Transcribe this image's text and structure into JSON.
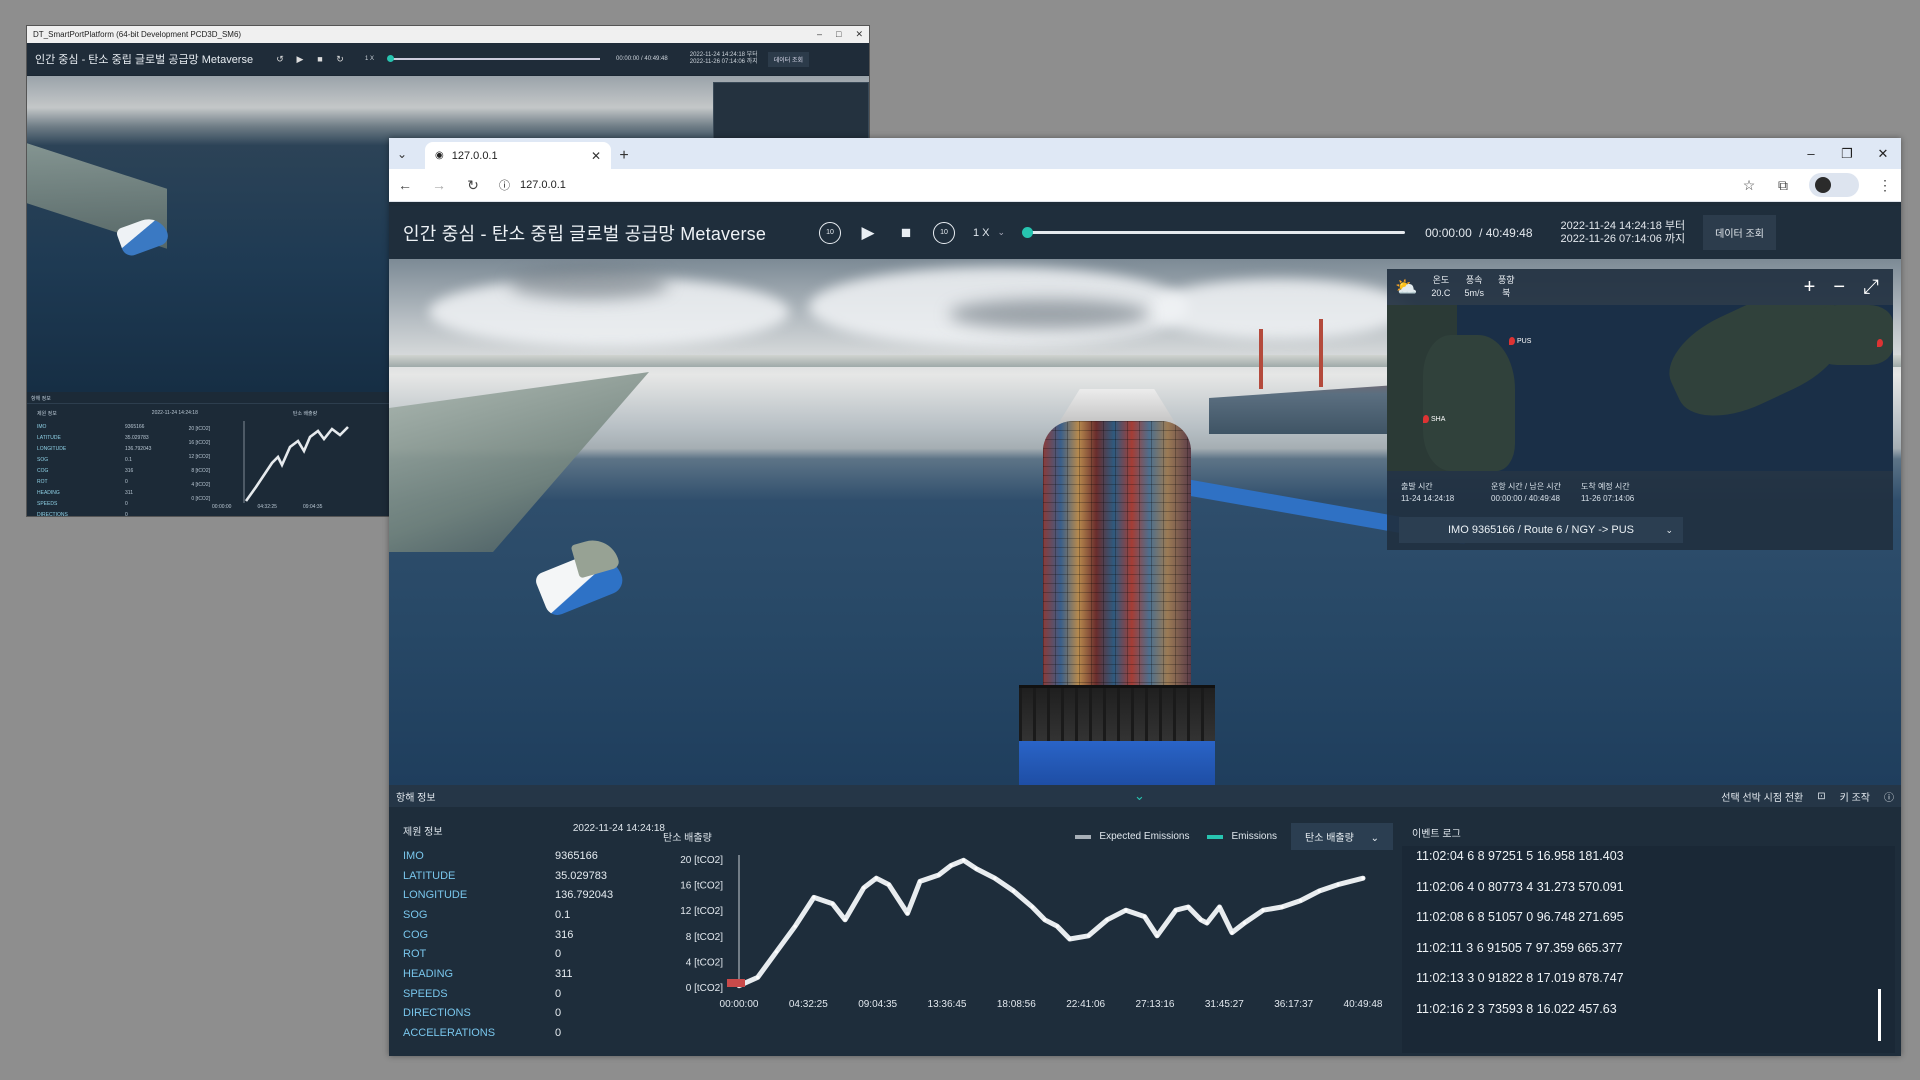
{
  "bg_window": {
    "title": "DT_SmartPortPlatform (64-bit Development PCD3D_SM6)",
    "app_title": "인간 중심 - 탄소 중립 글로벌 공급망 Metaverse",
    "speed": "1 X",
    "time": "00:00:00 / 40:49:48",
    "date_from": "2022-11-24 14:24:18 부터",
    "date_to": "2022-11-26 07:14:06 까지",
    "date_btn": "데이터 조회",
    "panel_title": "항해 정보",
    "spec_title": "제원 정보",
    "spec_date": "2022-11-24 14:24:18",
    "emission_title": "탄소 배출량",
    "rows": [
      {
        "k": "IMO",
        "v": "9365166"
      },
      {
        "k": "LATITUDE",
        "v": "35.029783"
      },
      {
        "k": "LONGITUDE",
        "v": "136.792043"
      },
      {
        "k": "SOG",
        "v": "0.1"
      },
      {
        "k": "COG",
        "v": "316"
      },
      {
        "k": "ROT",
        "v": "0"
      },
      {
        "k": "HEADING",
        "v": "311"
      },
      {
        "k": "SPEEDS",
        "v": "0"
      },
      {
        "k": "DIRECTIONS",
        "v": "0"
      },
      {
        "k": "ACCELERATIONS",
        "v": "0"
      }
    ],
    "y_ticks": [
      "20 [tCO2]",
      "16 [tCO2]",
      "12 [tCO2]",
      "8 [tCO2]",
      "4 [tCO2]",
      "0 [tCO2]"
    ],
    "x_ticks": [
      "00:00:00",
      "04:32:25",
      "09:04:35"
    ]
  },
  "browser": {
    "tab_title": "127.0.0.1",
    "url": "127.0.0.1"
  },
  "app": {
    "title": "인간 중심 - 탄소 중립 글로벌 공급망 Metaverse",
    "rewind_label": "10",
    "forward_label": "10",
    "speed": "1 X",
    "time_current": "00:00:00",
    "time_total": "/ 40:49:48",
    "progress": 0,
    "date_from": "2022-11-24 14:24:18 부터",
    "date_to": "2022-11-26 07:14:06 까지",
    "date_btn": "데이터 조회"
  },
  "weather": {
    "temp_label": "온도",
    "temp_value": "20.C",
    "wind_label": "풍속",
    "wind_value": "5m/s",
    "dir_label": "풍향",
    "dir_value": "북"
  },
  "minimap": {
    "ports": [
      "PUS",
      "SHA"
    ]
  },
  "voyage": {
    "depart_label": "출발 시간",
    "depart_value": "11-24 14:24:18",
    "elapsed_label": "운항 시간 / 남은 시간",
    "elapsed_value": "00:00:00 / 40:49:48",
    "arrive_label": "도착 예정 시간",
    "arrive_value": "11-26 07:14:06",
    "route": "IMO 9365166 / Route 6 / NGY -> PUS"
  },
  "bottom": {
    "title": "항해 정보",
    "view_switch": "선택 선박 시점 전환",
    "key_control": "키 조작"
  },
  "specs": {
    "title": "제원 정보",
    "date": "2022-11-24 14:24:18",
    "rows": [
      {
        "k": "IMO",
        "v": "9365166"
      },
      {
        "k": "LATITUDE",
        "v": "35.029783"
      },
      {
        "k": "LONGITUDE",
        "v": "136.792043"
      },
      {
        "k": "SOG",
        "v": "0.1"
      },
      {
        "k": "COG",
        "v": "316"
      },
      {
        "k": "ROT",
        "v": "0"
      },
      {
        "k": "HEADING",
        "v": "311"
      },
      {
        "k": "SPEEDS",
        "v": "0"
      },
      {
        "k": "DIRECTIONS",
        "v": "0"
      },
      {
        "k": "ACCELERATIONS",
        "v": "0"
      }
    ]
  },
  "chart_header": {
    "title": "탄소 배출량",
    "metric": "탄소 배출량"
  },
  "chart_data": {
    "type": "line",
    "title": "탄소 배출량",
    "ylim": [
      0,
      20
    ],
    "y_ticks": [
      20,
      16,
      12,
      8,
      4,
      0
    ],
    "y_tick_labels": [
      "20 [tCO2]",
      "16 [tCO2]",
      "12 [tCO2]",
      "8 [tCO2]",
      "4 [tCO2]",
      "0 [tCO2]"
    ],
    "x_tick_labels": [
      "00:00:00",
      "04:32:25",
      "09:04:35",
      "13:36:45",
      "18:08:56",
      "22:41:06",
      "27:13:16",
      "31:45:27",
      "36:17:37",
      "40:49:48"
    ],
    "legend_position": "top-right",
    "series": [
      {
        "name": "Expected Emissions",
        "color": "#a7afb7",
        "values": []
      },
      {
        "name": "Emissions",
        "color": "#e8ecef",
        "x_fraction": [
          0,
          0.03,
          0.06,
          0.09,
          0.12,
          0.15,
          0.17,
          0.2,
          0.22,
          0.24,
          0.27,
          0.29,
          0.32,
          0.34,
          0.36,
          0.38,
          0.41,
          0.44,
          0.47,
          0.49,
          0.51,
          0.53,
          0.56,
          0.59,
          0.62,
          0.65,
          0.67,
          0.7,
          0.72,
          0.74,
          0.75,
          0.77,
          0.79,
          0.81,
          0.84,
          0.87,
          0.9,
          0.93,
          0.96,
          1.0
        ],
        "values": [
          0.2,
          1.5,
          5.5,
          9.5,
          14.0,
          13.0,
          10.5,
          15.5,
          17.0,
          16.0,
          11.5,
          16.5,
          17.5,
          19.0,
          19.8,
          18.5,
          17.0,
          15.0,
          12.5,
          10.5,
          9.5,
          7.5,
          8.0,
          10.5,
          12.0,
          11.0,
          8.0,
          12.0,
          12.5,
          10.5,
          10.0,
          12.5,
          8.5,
          10.0,
          12.0,
          12.5,
          13.5,
          15.0,
          16.0,
          17.0
        ]
      }
    ]
  },
  "eventlog": {
    "title": "이벤트 로그",
    "lines": [
      "11:02:04 6 8 97251 5 16.958 181.403",
      "11:02:06 4 0 80773 4 31.273 570.091",
      "11:02:08 6 8 51057 0 96.748 271.695",
      "11:02:11 3 6 91505 7 97.359 665.377",
      "11:02:13 3 0 91822 8 17.019 878.747",
      "11:02:16 2 3 73593 8 16.022 457.63"
    ]
  },
  "colors": {
    "accent": "#27c4b0",
    "panel": "#1e2d3b",
    "label": "#79c6ec"
  }
}
